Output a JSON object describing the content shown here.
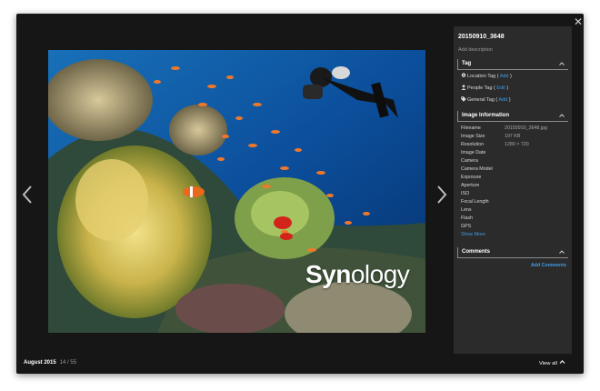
{
  "viewer": {
    "album": "August 2015",
    "position": "14 / 55",
    "view_all": "View all"
  },
  "photo": {
    "watermark_bold": "Syn",
    "watermark_rest": "ology"
  },
  "panel": {
    "title": "20150910_3648",
    "add_description": "Add description",
    "tag_section": "Tag",
    "location_tag": "Location Tag",
    "location_action": "Add",
    "people_tag": "People Tag",
    "people_action": "Edit",
    "general_tag": "General Tag",
    "general_action": "Add",
    "info_section": "Image Information",
    "info": [
      {
        "label": "Filename",
        "value": "20150910_3648.jpg"
      },
      {
        "label": "Image Size",
        "value": "197 KB"
      },
      {
        "label": "Resolution",
        "value": "1280 × 720"
      },
      {
        "label": "Image Date",
        "value": ""
      },
      {
        "label": "Camera",
        "value": ""
      },
      {
        "label": "Camera Model",
        "value": ""
      },
      {
        "label": "Exposure",
        "value": ""
      },
      {
        "label": "Aperture",
        "value": ""
      },
      {
        "label": "ISO",
        "value": ""
      },
      {
        "label": "Focal Length",
        "value": ""
      },
      {
        "label": "Lens",
        "value": ""
      },
      {
        "label": "Flash",
        "value": ""
      },
      {
        "label": "GPS",
        "value": ""
      }
    ],
    "show_more": "Show More",
    "comments_section": "Comments",
    "add_comments": "Add Comments"
  },
  "colors": {
    "background": "#161616",
    "panel": "#2b2b2b",
    "link": "#3d9be9"
  },
  "icons": [
    "close-icon",
    "chevron-left-icon",
    "chevron-right-icon",
    "location-pin-icon",
    "person-icon",
    "tag-icon",
    "chevron-up-icon"
  ]
}
